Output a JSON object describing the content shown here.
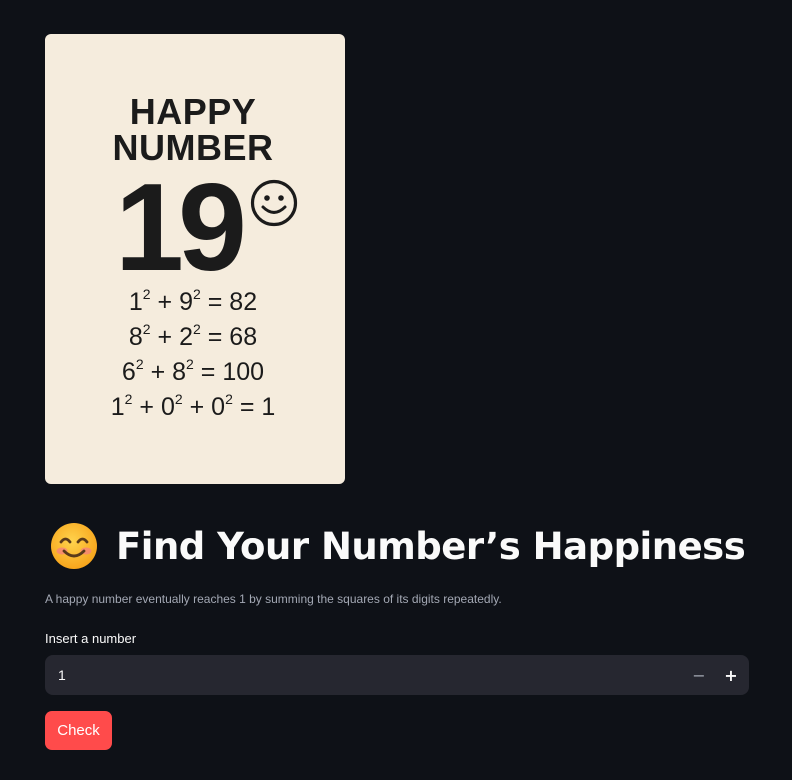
{
  "poster": {
    "line1": "HAPPY",
    "line2": "NUMBER",
    "big_number": "19",
    "equations": [
      {
        "a": "1",
        "a_exp": "2",
        "op1": "+",
        "b": "9",
        "b_exp": "2",
        "rest": "= 82"
      },
      {
        "a": "8",
        "a_exp": "2",
        "op1": "+",
        "b": "2",
        "b_exp": "2",
        "rest": "= 68"
      },
      {
        "a": "6",
        "a_exp": "2",
        "op1": "+",
        "b": "8",
        "b_exp": "2",
        "rest": "= 100"
      }
    ],
    "last_equation": {
      "a": "1",
      "a_exp": "2",
      "b": "0",
      "b_exp": "2",
      "c": "0",
      "c_exp": "2",
      "rest": "= 1"
    },
    "icon": "smiley-face-icon"
  },
  "header": {
    "emoji": "smiling-face-emoji",
    "title": "Find Your Number’s Happiness"
  },
  "caption": "A happy number eventually reaches 1 by summing the squares of its digits repeatedly.",
  "number_input": {
    "label": "Insert a number",
    "value": "1",
    "minus_label": "−",
    "plus_label": "+"
  },
  "check_button": {
    "label": "Check"
  },
  "colors": {
    "background": "#0e1117",
    "input_bg": "#262730",
    "button": "#ff4b4b",
    "poster_bg": "#f5ecdd"
  }
}
